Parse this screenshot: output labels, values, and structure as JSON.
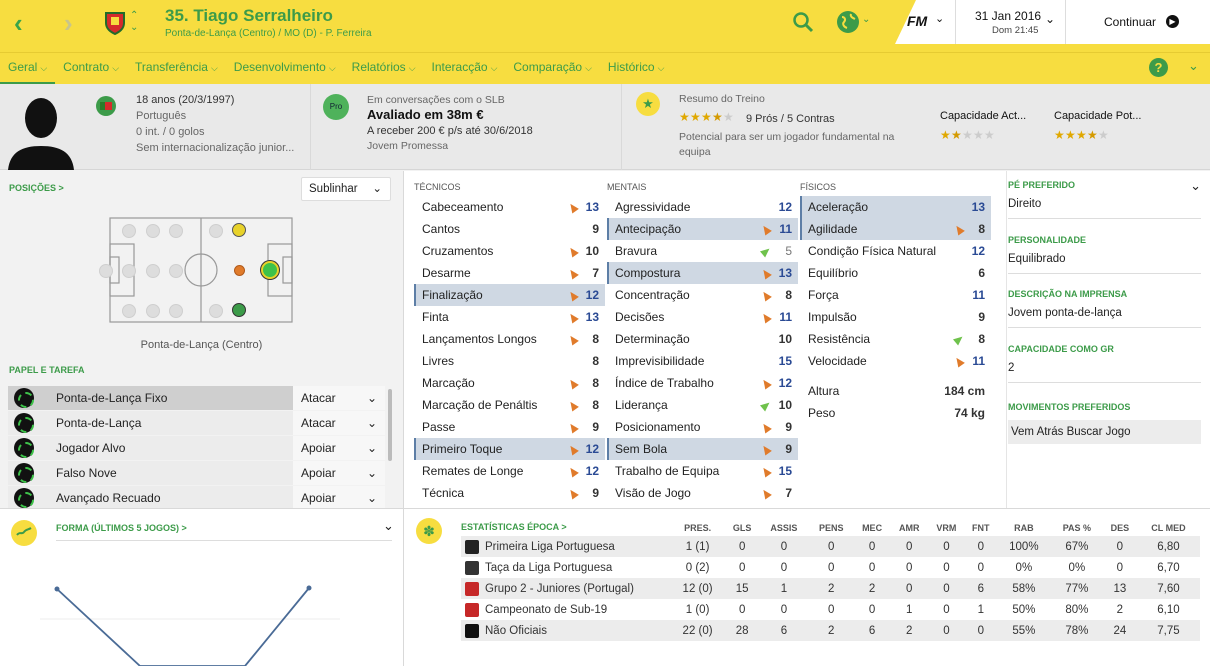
{
  "header": {
    "player_name": "35. Tiago Serralheiro",
    "subtitle": "Ponta-de-Lança (Centro) / MO (D) - P. Ferreira",
    "date": "31 Jan 2016",
    "time": "Dom 21:45",
    "continue_label": "Continuar",
    "fm_logo": "FM"
  },
  "tabs": [
    "Geral",
    "Contrato",
    "Transferência",
    "Desenvolvimento",
    "Relatórios",
    "Interacção",
    "Comparação",
    "Histórico"
  ],
  "profile": {
    "age": "18 anos (20/3/1997)",
    "nationality": "Português",
    "caps": "0 int. / 0 golos",
    "intl_status": "Sem internacionalização junior...",
    "pro_badge": "Pro",
    "talks": "Em conversações com o SLB",
    "value": "Avaliado em 38m €",
    "wage": "A receber 200 € p/s até 30/6/2018",
    "status": "Jovem Promessa",
    "training_title": "Resumo do Treino",
    "pros_cons": "9 Prós / 5 Contras",
    "training_desc": "Potencial para ser um jogador fundamental na equipa",
    "ca_label": "Capacidade Act...",
    "pa_label": "Capacidade Pot...",
    "rating_stars": 3.5,
    "ca_stars": 1.5,
    "pa_stars": 3.5
  },
  "positions": {
    "title": "POSIÇÕES >",
    "highlight_label": "Sublinhar",
    "position_name": "Ponta-de-Lança (Centro)"
  },
  "role_section": {
    "title": "PAPEL E TAREFA",
    "roles": [
      {
        "name": "Ponta-de-Lança Fixo",
        "duty": "Atacar"
      },
      {
        "name": "Ponta-de-Lança",
        "duty": "Atacar"
      },
      {
        "name": "Jogador Alvo",
        "duty": "Apoiar"
      },
      {
        "name": "Falso Nove",
        "duty": "Apoiar"
      },
      {
        "name": "Avançado Recuado",
        "duty": "Apoiar"
      }
    ]
  },
  "attributes": {
    "technical_title": "TÉCNICOS",
    "mental_title": "MENTAIS",
    "physical_title": "FÍSICOS",
    "technical": [
      {
        "name": "Cabeceamento",
        "value": "13"
      },
      {
        "name": "Cantos",
        "value": "9"
      },
      {
        "name": "Cruzamentos",
        "value": "10"
      },
      {
        "name": "Desarme",
        "value": "7"
      },
      {
        "name": "Finalização",
        "value": "12"
      },
      {
        "name": "Finta",
        "value": "13"
      },
      {
        "name": "Lançamentos Longos",
        "value": "8"
      },
      {
        "name": "Livres",
        "value": "8"
      },
      {
        "name": "Marcação",
        "value": "8"
      },
      {
        "name": "Marcação de Penáltis",
        "value": "8"
      },
      {
        "name": "Passe",
        "value": "9"
      },
      {
        "name": "Primeiro Toque",
        "value": "12"
      },
      {
        "name": "Remates de Longe",
        "value": "12"
      },
      {
        "name": "Técnica",
        "value": "9"
      }
    ],
    "mental": [
      {
        "name": "Agressividade",
        "value": "12"
      },
      {
        "name": "Antecipação",
        "value": "11"
      },
      {
        "name": "Bravura",
        "value": "5"
      },
      {
        "name": "Compostura",
        "value": "13"
      },
      {
        "name": "Concentração",
        "value": "8"
      },
      {
        "name": "Decisões",
        "value": "11"
      },
      {
        "name": "Determinação",
        "value": "10"
      },
      {
        "name": "Imprevisibilidade",
        "value": "15"
      },
      {
        "name": "Índice de Trabalho",
        "value": "12"
      },
      {
        "name": "Liderança",
        "value": "10"
      },
      {
        "name": "Posicionamento",
        "value": "9"
      },
      {
        "name": "Sem Bola",
        "value": "9"
      },
      {
        "name": "Trabalho de Equipa",
        "value": "15"
      },
      {
        "name": "Visão de Jogo",
        "value": "7"
      }
    ],
    "physical": [
      {
        "name": "Aceleração",
        "value": "13"
      },
      {
        "name": "Agilidade",
        "value": "8"
      },
      {
        "name": "Condição Física Natural",
        "value": "12"
      },
      {
        "name": "Equilíbrio",
        "value": "6"
      },
      {
        "name": "Força",
        "value": "11"
      },
      {
        "name": "Impulsão",
        "value": "9"
      },
      {
        "name": "Resistência",
        "value": "8"
      },
      {
        "name": "Velocidade",
        "value": "11"
      }
    ],
    "height_label": "Altura",
    "height": "184 cm",
    "weight_label": "Peso",
    "weight": "74 kg"
  },
  "info": {
    "foot_title": "PÉ PREFERIDO",
    "foot": "Direito",
    "personality_title": "PERSONALIDADE",
    "personality": "Equilibrado",
    "media_title": "DESCRIÇÃO NA IMPRENSA",
    "media": "Jovem ponta-de-lança",
    "gk_title": "CAPACIDADE COMO GR",
    "gk": "2",
    "moves_title": "MOVIMENTOS PREFERIDOS",
    "moves": "Vem Atrás Buscar Jogo"
  },
  "form": {
    "title": "FORMA (ÚLTIMOS 5 JOGOS) >"
  },
  "season_stats": {
    "title": "ESTATÍSTICAS ÉPOCA >",
    "columns": [
      "PRES.",
      "GLS",
      "ASSIS",
      "PENS",
      "MEC",
      "AMR",
      "VRM",
      "FNT",
      "RAB",
      "PAS %",
      "DES",
      "CL MED"
    ],
    "rows": [
      {
        "comp": "Primeira Liga Portuguesa",
        "values": [
          "1 (1)",
          "0",
          "0",
          "0",
          "0",
          "0",
          "0",
          "0",
          "100%",
          "67%",
          "0",
          "6,80"
        ]
      },
      {
        "comp": "Taça da Liga Portuguesa",
        "values": [
          "0 (2)",
          "0",
          "0",
          "0",
          "0",
          "0",
          "0",
          "0",
          "0%",
          "0%",
          "0",
          "6,70"
        ]
      },
      {
        "comp": "Grupo 2 - Juniores (Portugal)",
        "values": [
          "12 (0)",
          "15",
          "1",
          "2",
          "2",
          "0",
          "0",
          "6",
          "58%",
          "77%",
          "13",
          "7,60"
        ]
      },
      {
        "comp": "Campeonato de Sub-19",
        "values": [
          "1 (0)",
          "0",
          "0",
          "0",
          "0",
          "1",
          "0",
          "1",
          "50%",
          "80%",
          "2",
          "6,10"
        ]
      },
      {
        "comp": "Não Oficiais",
        "values": [
          "22 (0)",
          "28",
          "6",
          "2",
          "6",
          "2",
          "0",
          "0",
          "55%",
          "78%",
          "24",
          "7,75"
        ]
      }
    ]
  },
  "colors": {
    "accent_yellow": "#f7dd40",
    "accent_green": "#3c9b49",
    "highlight_row": "#cfd8e3"
  }
}
